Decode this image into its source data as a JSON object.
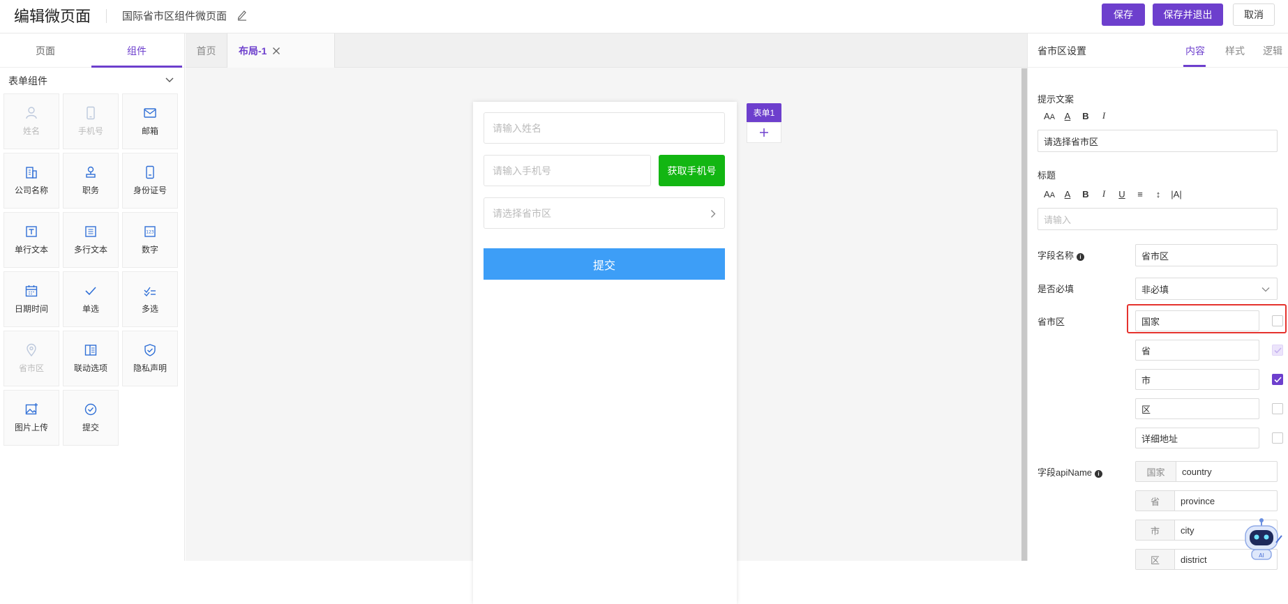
{
  "header": {
    "page_title": "编辑微页面",
    "sub_title": "国际省市区组件微页面",
    "save_label": "保存",
    "save_exit_label": "保存并退出",
    "cancel_label": "取消"
  },
  "left_panel": {
    "tabs": [
      {
        "label": "页面"
      },
      {
        "label": "组件"
      }
    ],
    "group_title": "表单组件",
    "components": [
      {
        "label": "姓名",
        "icon": "user-icon",
        "disabled": true
      },
      {
        "label": "手机号",
        "icon": "phone-icon",
        "disabled": true
      },
      {
        "label": "邮箱",
        "icon": "mail-icon",
        "disabled": false
      },
      {
        "label": "公司名称",
        "icon": "building-icon",
        "disabled": false
      },
      {
        "label": "职务",
        "icon": "stamp-icon",
        "disabled": false
      },
      {
        "label": "身份证号",
        "icon": "id-card-icon",
        "disabled": false
      },
      {
        "label": "单行文本",
        "icon": "text-line-icon",
        "disabled": false
      },
      {
        "label": "多行文本",
        "icon": "text-multi-icon",
        "disabled": false
      },
      {
        "label": "数字",
        "icon": "number-icon",
        "disabled": false
      },
      {
        "label": "日期时间",
        "icon": "calendar-icon",
        "disabled": false
      },
      {
        "label": "单选",
        "icon": "check-icon",
        "disabled": false
      },
      {
        "label": "多选",
        "icon": "multi-check-icon",
        "disabled": false
      },
      {
        "label": "省市区",
        "icon": "location-icon",
        "disabled": true
      },
      {
        "label": "联动选项",
        "icon": "linkage-icon",
        "disabled": false
      },
      {
        "label": "隐私声明",
        "icon": "shield-icon",
        "disabled": false
      },
      {
        "label": "图片上传",
        "icon": "image-icon",
        "disabled": false
      },
      {
        "label": "提交",
        "icon": "submit-check-icon",
        "disabled": false
      }
    ]
  },
  "canvas": {
    "tabs": [
      {
        "label": "首页"
      },
      {
        "label": "布局-1"
      }
    ],
    "form": {
      "name_placeholder": "请输入姓名",
      "phone_placeholder": "请输入手机号",
      "get_phone_label": "获取手机号",
      "region_placeholder": "请选择省市区",
      "submit_label": "提交"
    },
    "form_tag": "表单1"
  },
  "right_panel": {
    "title": "省市区设置",
    "tabs": [
      {
        "label": "内容"
      },
      {
        "label": "样式"
      },
      {
        "label": "逻辑"
      }
    ],
    "hint_label": "提示文案",
    "hint_value": "请选择省市区",
    "title_label": "标题",
    "title_placeholder": "请输入",
    "field_name_label": "字段名称",
    "field_name_value": "省市区",
    "required_label": "是否必填",
    "required_value": "非必填",
    "region_label": "省市区",
    "region_levels": [
      {
        "label": "国家",
        "checked": false
      },
      {
        "label": "省",
        "checked": true
      },
      {
        "label": "市",
        "checked": true
      },
      {
        "label": "区",
        "checked": false
      },
      {
        "label": "详细地址",
        "checked": false
      }
    ],
    "api_label": "字段apiName",
    "api_rows": [
      {
        "prefix": "国家",
        "value": "country"
      },
      {
        "prefix": "省",
        "value": "province"
      },
      {
        "prefix": "市",
        "value": "city"
      },
      {
        "prefix": "区",
        "value": "district"
      }
    ]
  },
  "colors": {
    "accent": "#6d3fcd",
    "green": "#12b612",
    "submit_blue": "#3d9ef7",
    "highlight": "#e5322d"
  }
}
